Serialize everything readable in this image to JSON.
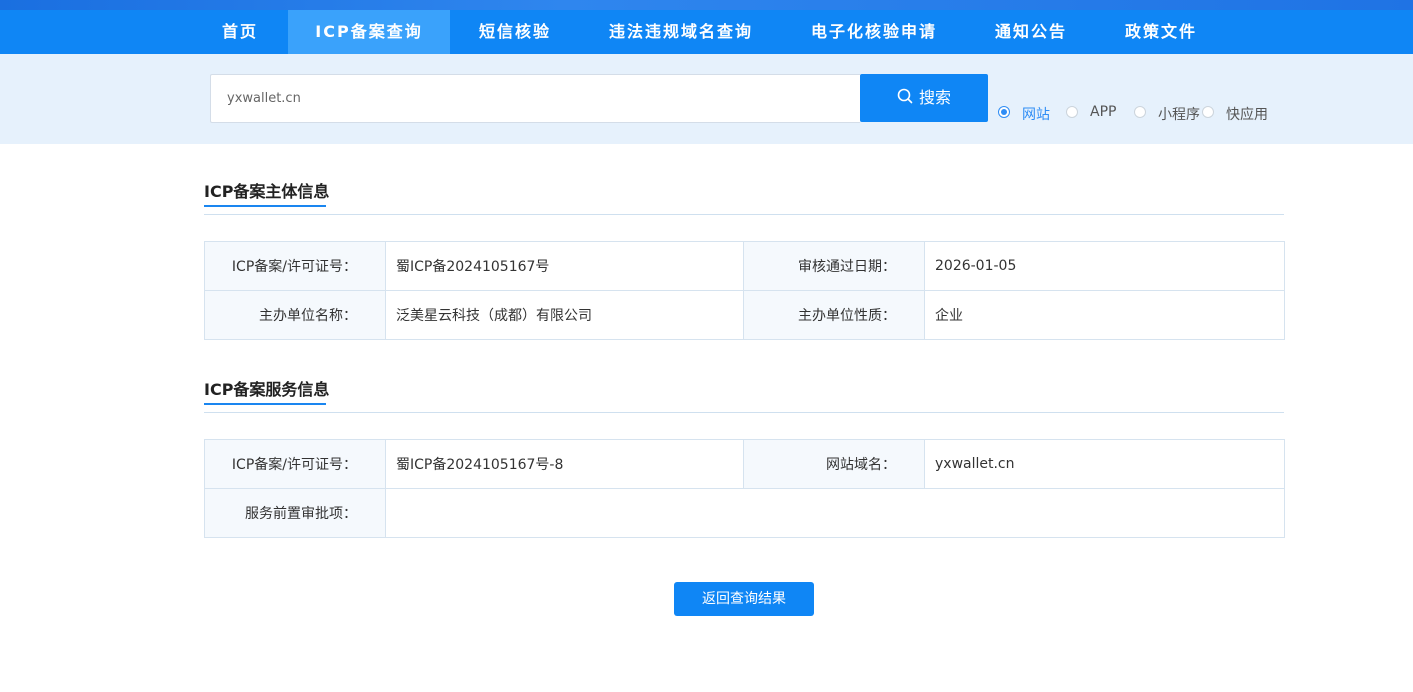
{
  "nav": {
    "items": [
      {
        "label": "首页"
      },
      {
        "label": "ICP备案查询"
      },
      {
        "label": "短信核验"
      },
      {
        "label": "违法违规域名查询"
      },
      {
        "label": "电子化核验申请"
      },
      {
        "label": "通知公告"
      },
      {
        "label": "政策文件"
      }
    ],
    "active_index": 1
  },
  "search": {
    "value": "yxwallet.cn",
    "button_label": "搜索",
    "options": [
      "网站",
      "APP",
      "小程序",
      "快应用"
    ],
    "selected_option": "网站"
  },
  "subject_info": {
    "title": "ICP备案主体信息",
    "rows": [
      {
        "label1": "ICP备案/许可证号：",
        "value1": "蜀ICP备2024105167号",
        "label2": "审核通过日期：",
        "value2": "2026-01-05"
      },
      {
        "label1": "主办单位名称：",
        "value1": "泛美星云科技（成都）有限公司",
        "label2": "主办单位性质：",
        "value2": "企业"
      }
    ]
  },
  "service_info": {
    "title": "ICP备案服务信息",
    "rows": [
      {
        "label1": "ICP备案/许可证号：",
        "value1": "蜀ICP备2024105167号-8",
        "label2": "网站域名：",
        "value2": "yxwallet.cn"
      },
      {
        "label1": "服务前置审批项：",
        "value1": ""
      }
    ]
  },
  "back_button_label": "返回查询结果",
  "colors": {
    "primary": "#0f86f5",
    "active_tab": "#3aa2fb",
    "search_band": "#e6f1fc"
  }
}
